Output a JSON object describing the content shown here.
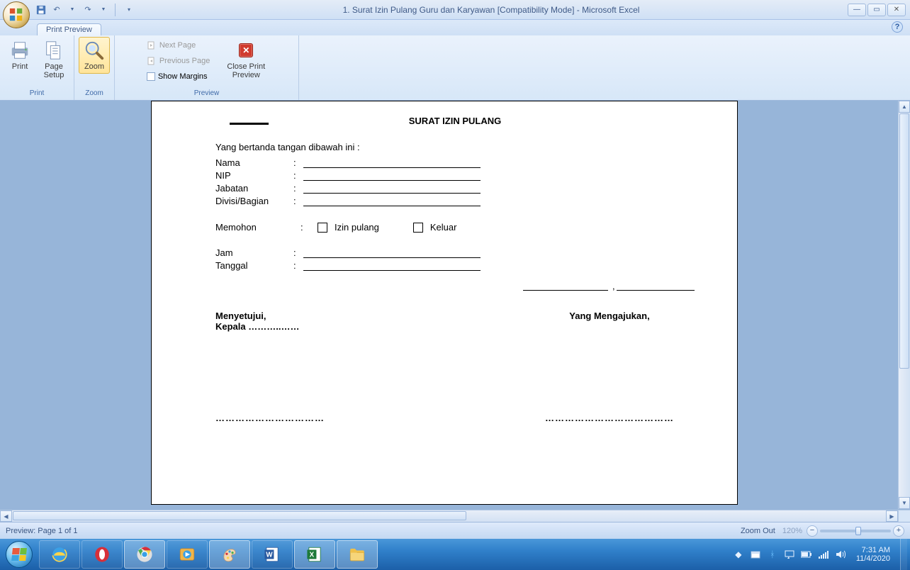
{
  "titlebar": {
    "title": "1. Surat Izin Pulang Guru dan Karyawan  [Compatibility Mode] - Microsoft Excel"
  },
  "tab": {
    "label": "Print Preview"
  },
  "ribbon": {
    "print_group": {
      "label": "Print",
      "print": "Print",
      "page_setup": "Page\nSetup"
    },
    "zoom_group": {
      "label": "Zoom",
      "zoom": "Zoom"
    },
    "preview_group": {
      "label": "Preview",
      "next_page": "Next Page",
      "previous_page": "Previous Page",
      "show_margins": "Show Margins",
      "close": "Close Print\nPreview"
    }
  },
  "document": {
    "title": "SURAT IZIN PULANG",
    "intro": "Yang bertanda tangan dibawah ini :",
    "fields": {
      "nama": "Nama",
      "nip": "NIP",
      "jabatan": "Jabatan",
      "divisi": "Divisi/Bagian",
      "memohon": "Memohon",
      "izin_pulang": "Izin pulang",
      "keluar": "Keluar",
      "jam": "Jam",
      "tanggal": "Tanggal"
    },
    "sign": {
      "left1": "Menyetujui,",
      "left2": "Kepala ………..……",
      "right": "Yang Mengajukan,",
      "dots_left": "……………………………",
      "dots_right": "…………………………………"
    }
  },
  "statusbar": {
    "left": "Preview: Page 1 of 1",
    "zoom_label": "Zoom Out",
    "zoom_pct": "120%"
  },
  "tray": {
    "time": "7:31 AM",
    "date": "11/4/2020"
  }
}
